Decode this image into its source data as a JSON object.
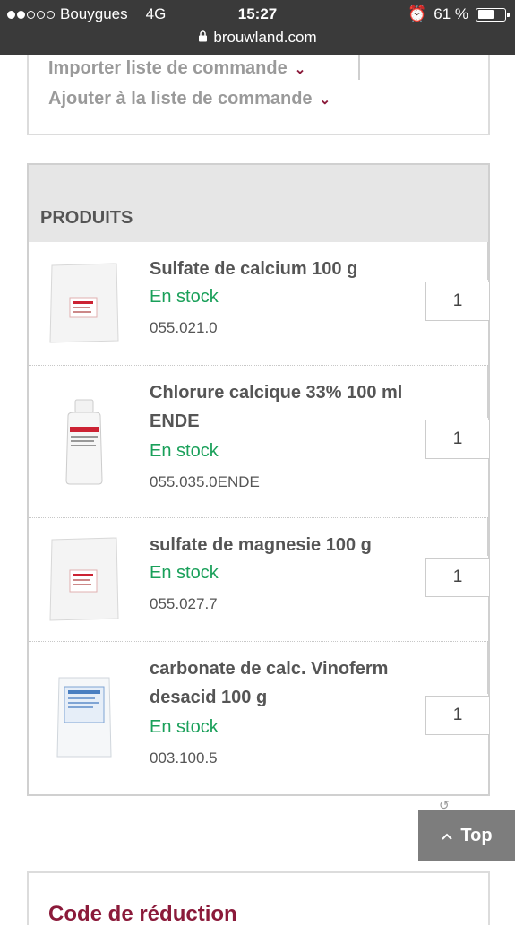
{
  "status_bar": {
    "carrier": "Bouygues",
    "network": "4G",
    "time": "15:27",
    "battery": "61 %",
    "battery_level": 0.61,
    "url": "brouwland.com"
  },
  "order_links": {
    "import": "Importer liste de commande",
    "add": "Ajouter à la liste de commande"
  },
  "products": {
    "header": "PRODUITS",
    "items": [
      {
        "name": "Sulfate de calcium 100 g",
        "stock": "En stock",
        "sku": "055.021.0",
        "qty": "1",
        "icon": "powder-bag"
      },
      {
        "name": "Chlorure calcique 33% 100 ml ENDE",
        "stock": "En stock",
        "sku": "055.035.0ENDE",
        "qty": "1",
        "icon": "bottle"
      },
      {
        "name": "sulfate de magnesie 100 g",
        "stock": "En stock",
        "sku": "055.027.7",
        "qty": "1",
        "icon": "powder-bag"
      },
      {
        "name": "carbonate de calc. Vinoferm desacid 100 g",
        "stock": "En stock",
        "sku": "003.100.5",
        "qty": "1",
        "icon": "powder-bag-blue"
      }
    ]
  },
  "top_button": {
    "label": "Top"
  },
  "reduction": {
    "title": "Code de réduction"
  },
  "colors": {
    "accent": "#8b1a3a",
    "stock_green": "#1aa05a",
    "text_gray": "#555555"
  }
}
